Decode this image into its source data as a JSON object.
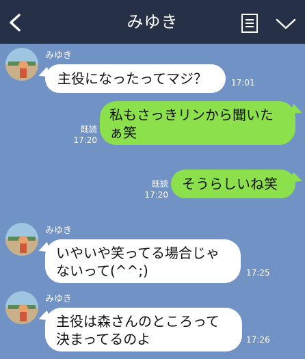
{
  "header": {
    "title": "みゆき",
    "back_icon": "back-chevron-icon",
    "memo_icon": "note-icon",
    "menu_icon": "chevron-down-icon",
    "background": "#263046"
  },
  "chat": {
    "background": "#7192c4",
    "incoming_bubble_color": "#ffffff",
    "outgoing_bubble_color": "#8be04b",
    "messages": [
      {
        "sender": "みゆき",
        "text": "主役になったってマジ？",
        "time": "17:01"
      },
      {
        "read": "既読",
        "text_line1": "私もさっきリンから聞いた",
        "text_line2": "ぁ笑",
        "time": "17:20"
      },
      {
        "read": "既読",
        "text": "そうらしいね笑",
        "time": "17:20"
      },
      {
        "sender": "みゆき",
        "text_line1": "いやいや笑ってる場合じゃ",
        "text_line2": "ないって(^^;)",
        "time": "17:25"
      },
      {
        "sender": "みゆき",
        "text_line1": "主役は森さんのところって",
        "text_line2": "決まってるのよ",
        "time": "17:26"
      }
    ]
  }
}
